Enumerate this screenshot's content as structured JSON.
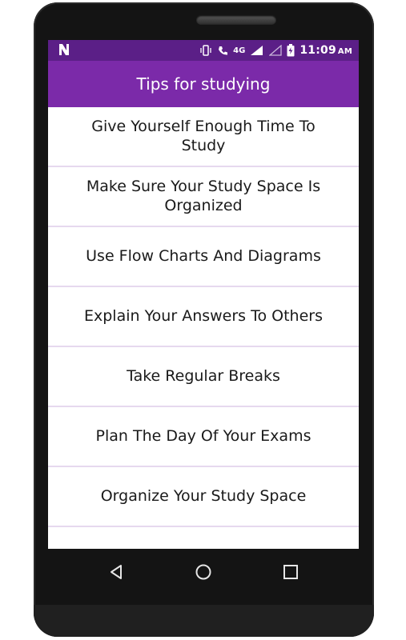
{
  "status_bar": {
    "notification_icon": "n-app-icon",
    "network_label": "4G",
    "time": "11:09",
    "ampm": "AM"
  },
  "app_bar": {
    "title": "Tips for studying",
    "color": "#7b2aa9"
  },
  "tips": [
    "Give Yourself Enough Time To Study",
    "Make Sure Your Study Space Is Organized",
    "Use Flow Charts And Diagrams",
    "Explain Your Answers To Others",
    "Take Regular Breaks",
    "Plan The Day Of Your Exams",
    "Organize Your Study Space",
    ""
  ],
  "nav": {
    "back": "back-icon",
    "home": "home-icon",
    "recents": "recents-icon"
  }
}
